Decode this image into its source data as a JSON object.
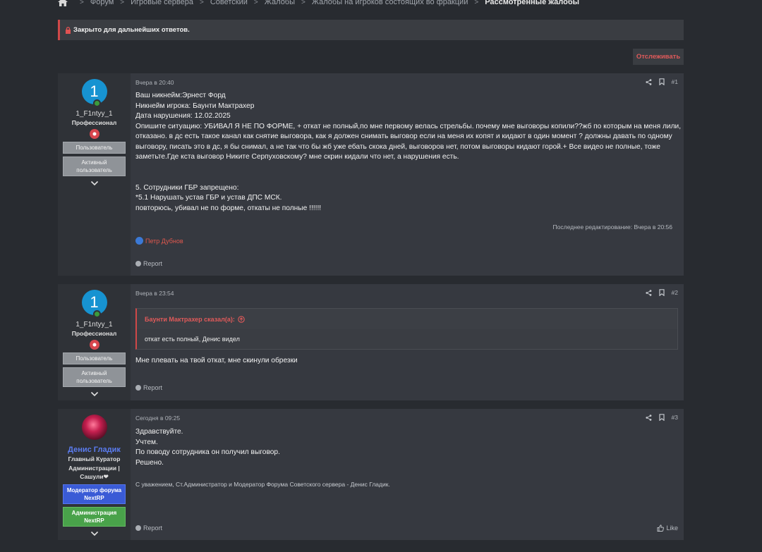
{
  "breadcrumb": {
    "items": [
      "Форум",
      "Игровые сервера",
      "Советский",
      "Жалобы",
      "Жалобы на игроков состоящих во фракции"
    ],
    "current": "Рассмотренные жалобы"
  },
  "notice": {
    "text": "Закрыто для дальнейших ответов."
  },
  "watch_button": {
    "label": "Отслеживать"
  },
  "posts": [
    {
      "author": {
        "avatar_letter": "1",
        "name": "1_F1ntyy_1",
        "title": "Профессионал",
        "banners": [
          "Пользователь",
          "Активный пользователь"
        ]
      },
      "date": "Вчера в 20:40",
      "number": "#1",
      "lines": [
        "Ваш никнейм:Эрнест Форд",
        "Никнейм игрока: Баунти Мактрахер",
        "Дата нарушения: 12.02.2025",
        "Опишите ситуацию: УБИВАЛ Я НЕ ПО ФОРМЕ, + откат не полный,по мне первому велась стрельбы. почему мне выговоры копили??жб по которым на меня лили, отказано. в дс есть такое канал как снятие выговора, как я должен снимать выговор если на меня их копят и кидают в один момент ? должны давать по одному выговору, писать это в дс, я бы снимал, а не так что бы жб уже ебать скока дней, выговоров нет, потом выговоры кидают горой.+ Все видео не полные, тоже заметьте.Где кста выговор Никите Серпуховскому? мне скрин кидали что нет, а нарушения есть.",
        "",
        "5. Сотрудники ГБР запрещено:",
        "*5.1 Нарушать устав ГБР и устав ДПС МСК.",
        "повторюсь, убивал не по форме, откаты не полные !!!!!!"
      ],
      "edited": "Последнее редактирование: Вчера в 20:56",
      "reaction_by": "Петр Дубнов",
      "report_label": "Report"
    },
    {
      "author": {
        "avatar_letter": "1",
        "name": "1_F1ntyy_1",
        "title": "Профессионал",
        "banners": [
          "Пользователь",
          "Активный пользователь"
        ]
      },
      "date": "Вчера в 23:54",
      "number": "#2",
      "quote": {
        "header": "Баунти Мактрахер сказал(а):",
        "text": "откат есть полный, Денис видел"
      },
      "text": "Мне плевать на твой откат, мне скинули обрезки",
      "report_label": "Report"
    },
    {
      "author": {
        "name": "Денис Гладик",
        "title": "Главный Куратор Администрации | Сашули❤",
        "banners": [
          "Модератор форума NextRP",
          "Администрация NextRP"
        ]
      },
      "date": "Сегодня в 09:25",
      "number": "#3",
      "lines": [
        "Здравствуйте.",
        "Учтем.",
        "По поводу сотрудника он получил выговор.",
        "Решено."
      ],
      "signature": "С уважением, Ст.Администратор и Модератор Форума Советского сервера - Денис Гладик.",
      "report_label": "Report",
      "like_label": "Like"
    }
  ],
  "colors": {
    "accent_red": "#d04848",
    "staff_name": "#5b7cf0",
    "avatar_blue": "#1793d1"
  }
}
